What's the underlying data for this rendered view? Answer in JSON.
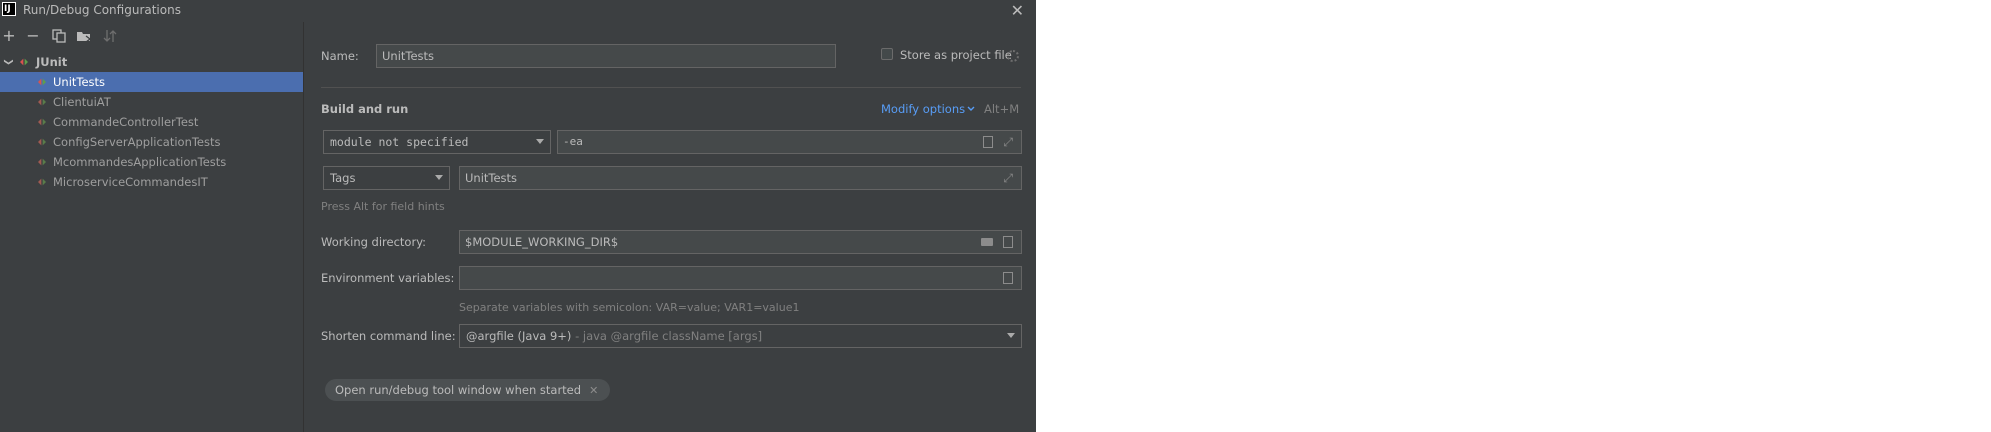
{
  "window": {
    "title": "Run/Debug Configurations",
    "app_icon": "IJ",
    "close_glyph": "✕"
  },
  "toolbar": {
    "add": "+",
    "remove": "−",
    "copy_icon": "copy-icon",
    "folder_icon": "new-folder-icon",
    "sort_icon": "sort-icon"
  },
  "tree": {
    "group": {
      "label": "JUnit",
      "chevron": "❯"
    },
    "items": [
      {
        "label": "UnitTests",
        "selected": true
      },
      {
        "label": "ClientuiAT",
        "selected": false
      },
      {
        "label": "CommandeControllerTest",
        "selected": false
      },
      {
        "label": "ConfigServerApplicationTests",
        "selected": false
      },
      {
        "label": "McommandesApplicationTests",
        "selected": false
      },
      {
        "label": "MicroserviceCommandesIT",
        "selected": false
      }
    ]
  },
  "form": {
    "name_label": "Name:",
    "name_value": "UnitTests",
    "store_label": "Store as project file",
    "build_run": "Build and run",
    "modify_options": "Modify options",
    "modify_shortcut": "Alt+M",
    "module": "module not specified",
    "vm_options": "-ea",
    "test_kind": "Tags",
    "tags_value": "UnitTests",
    "field_hint": "Press Alt for field hints",
    "workdir_label": "Working directory:",
    "workdir_value": "$MODULE_WORKING_DIR$",
    "env_label": "Environment variables:",
    "env_value": "",
    "env_hint": "Separate variables with semicolon: VAR=value; VAR1=value1",
    "shorten_label": "Shorten command line:",
    "shorten_value": "@argfile (Java 9+)",
    "shorten_hint": " - java @argfile className [args]",
    "chip_label": "Open run/debug tool window when started",
    "chip_close": "✕"
  },
  "colors": {
    "background": "#3c3f41",
    "selection": "#4b6eaf",
    "link": "#589df6",
    "junit_green": "#5f9e4b",
    "junit_red": "#d9534f"
  }
}
